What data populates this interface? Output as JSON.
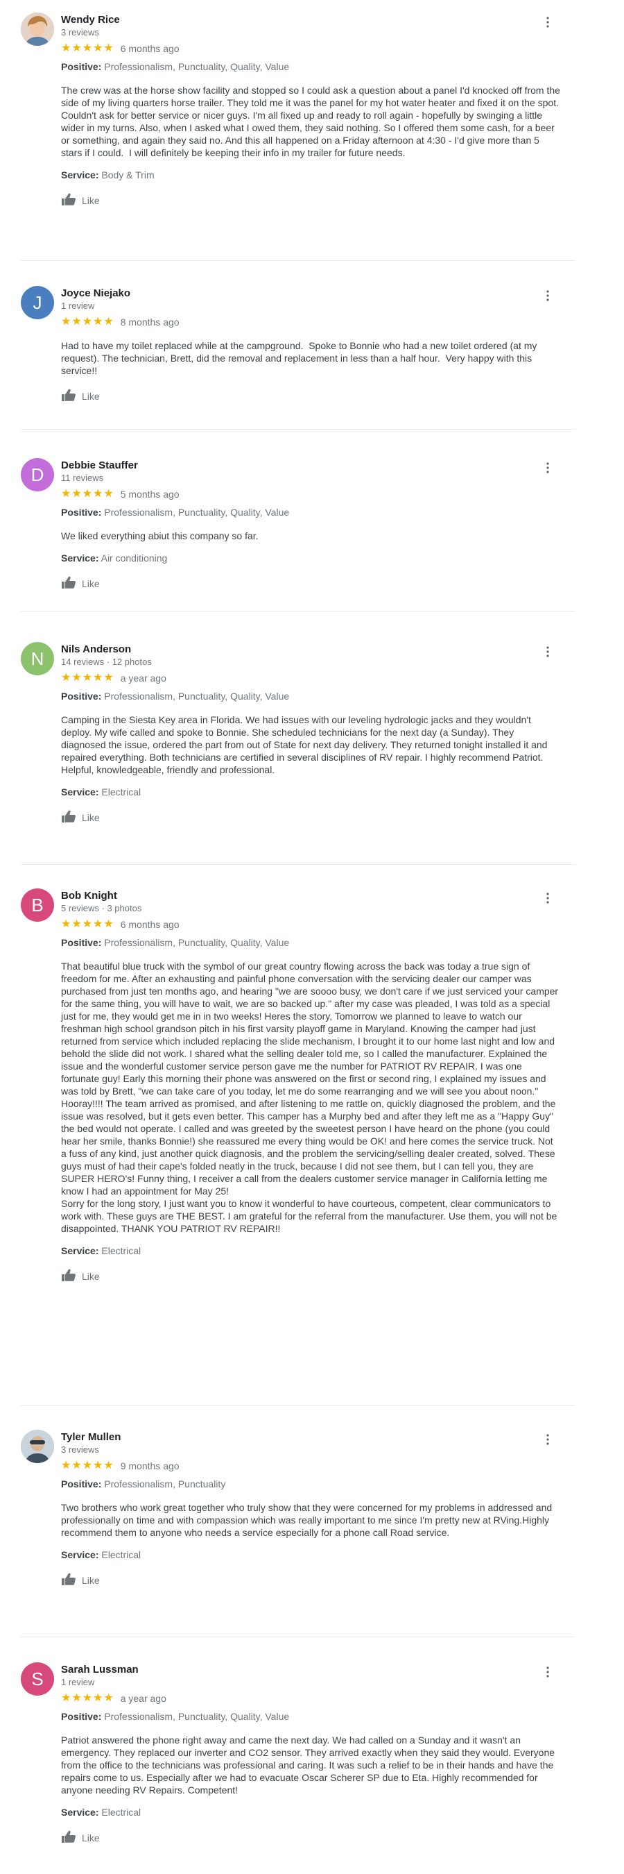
{
  "common": {
    "like_label": "Like",
    "positive_label": "Positive:",
    "service_label": "Service:"
  },
  "colors": {
    "star": "#f4b400",
    "muted": "#70757a"
  },
  "reviews": [
    {
      "name": "Wendy Rice",
      "meta": "3 reviews",
      "avatar_letter": "",
      "avatar_color": "#d9c2b5",
      "rating": 5,
      "date": "6 months ago",
      "positive": "Professionalism, Punctuality, Quality, Value",
      "text": "The crew was at the horse show facility and stopped so I could ask a question about a panel I'd knocked off from the side of my living quarters horse trailer. They told me it was the panel for my hot water heater and fixed it on the spot. Couldn't ask for better service or nicer guys. I'm all fixed up and ready to roll again - hopefully by swinging a little wider in my turns. Also, when I asked what I owed them, they said nothing. So I offered them some cash, for a beer or something, and again they said no. And this all happened on a Friday afternoon at 4:30 - I'd give more than 5 stars if I could.  I will definitely be keeping their info in my trailer for future needs.",
      "service": "Body & Trim"
    },
    {
      "name": "Joyce Niejako",
      "meta": "1 review",
      "avatar_letter": "J",
      "avatar_color": "#4a7fbf",
      "rating": 5,
      "date": "8 months ago",
      "positive": "",
      "text": "Had to have my toilet replaced while at the campground.  Spoke to Bonnie who had a new toilet ordered (at my request). The technician, Brett, did the removal and replacement in less than a half hour.  Very happy with this service!!",
      "service": ""
    },
    {
      "name": "Debbie Stauffer",
      "meta": "11 reviews",
      "avatar_letter": "D",
      "avatar_color": "#c36ddb",
      "rating": 5,
      "date": "5 months ago",
      "positive": "Professionalism, Punctuality, Quality, Value",
      "text": "We liked everything abiut this company so far.",
      "service": "Air conditioning"
    },
    {
      "name": "Nils Anderson",
      "meta": "14 reviews · 12 photos",
      "avatar_letter": "N",
      "avatar_color": "#8bc26b",
      "rating": 5,
      "date": "a year ago",
      "positive": "Professionalism, Punctuality, Quality, Value",
      "text": "Camping in the Siesta Key area in Florida. We had issues with our leveling hydrologic jacks and they wouldn't deploy. My wife called and spoke to Bonnie. She scheduled technicians for the next day (a Sunday). They diagnosed the issue, ordered the part from out of State for next day delivery. They returned tonight installed it and repaired everything. Both technicians are certified in several disciplines of RV repair. I highly recommend Patriot. Helpful, knowledgeable, friendly and professional.",
      "service": "Electrical"
    },
    {
      "name": "Bob Knight",
      "meta": "5 reviews · 3 photos",
      "avatar_letter": "B",
      "avatar_color": "#d6497a",
      "rating": 5,
      "date": "6 months ago",
      "positive": "Professionalism, Punctuality, Quality, Value",
      "text": "That beautiful blue truck with the symbol of our great country flowing across the back was today a true sign of freedom for me. After an exhausting and painful phone conversation with the servicing dealer our camper was purchased from just ten months ago, and hearing \"we are soooo busy, we don't care if we just serviced your camper for the same thing, you will have to wait, we are so backed up.\" after my case was pleaded, I was told as a special just for me, they would get me in in two weeks! Heres the story, Tomorrow we planned to leave to watch our freshman high school grandson pitch in his first varsity playoff game in Maryland. Knowing the camper had just returned from service which included replacing the slide mechanism, I brought it to our home last night and low and behold the slide did not work. I shared what the selling dealer told me, so I called the manufacturer. Explained the issue and the wonderful customer service person gave me the number for PATRIOT RV REPAIR. I was one fortunate guy! Early this morning their phone was answered on the first or second ring, I explained my issues and was told by Brett, \"we can take care of you today, let me do some rearranging and we will see you about noon.\" Hooray!!!! The team arrived as promised, and after listening to me rattle on, quickly diagnosed the problem, and the issue was resolved, but it gets even better. This camper has a Murphy bed and after they left me as a \"Happy Guy\" the bed would not operate. I called and was greeted by the sweetest person I have heard on the phone (you could hear her smile, thanks Bonnie!) she reassured me every thing would be OK! and here comes the service truck. Not a fuss of any kind, just another quick diagnosis, and the problem the servicing/selling dealer created, solved. These guys must of had their cape's folded neatly in the truck, because I did not see them, but I can tell you, they are SUPER HERO's! Funny thing, I receiver a call from the dealers customer service manager in California letting me know I had an appointment for May 25!\nSorry for the long story, I just want you to know it wonderful to have courteous, competent, clear communicators to work with. These guys are THE BEST. I am grateful for the referral from the manufacturer. Use them, you will not be disappointed. THANK YOU PATRIOT RV REPAIR!!",
      "service": "Electrical"
    },
    {
      "name": "Tyler Mullen",
      "meta": "3 reviews",
      "avatar_letter": "",
      "avatar_color": "#7a8a99",
      "rating": 5,
      "date": "9 months ago",
      "positive": "Professionalism, Punctuality",
      "text": "Two brothers who work great together who truly show that they were concerned for my problems in addressed and professionally on time and with compassion which was really important to me since I'm pretty new at RVing.Highly recommend them to anyone who needs a service especially for a phone call Road service.",
      "service": "Electrical"
    },
    {
      "name": "Sarah Lussman",
      "meta": "1 review",
      "avatar_letter": "S",
      "avatar_color": "#d6497a",
      "rating": 5,
      "date": "a year ago",
      "positive": "Professionalism, Punctuality, Quality, Value",
      "text": "Patriot answered the phone right away and came the next day. We had called on a Sunday and it wasn't an emergency. They replaced our inverter and CO2 sensor. They arrived exactly when they said they would. Everyone from the office to the technicians was professional and caring. It was such a relief to be in their hands and have the repairs come to us. Especially after we had to evacuate Oscar Scherer SP due to Eta. Highly recommended for anyone needing RV Repairs. Competent!",
      "service": "Electrical"
    }
  ]
}
